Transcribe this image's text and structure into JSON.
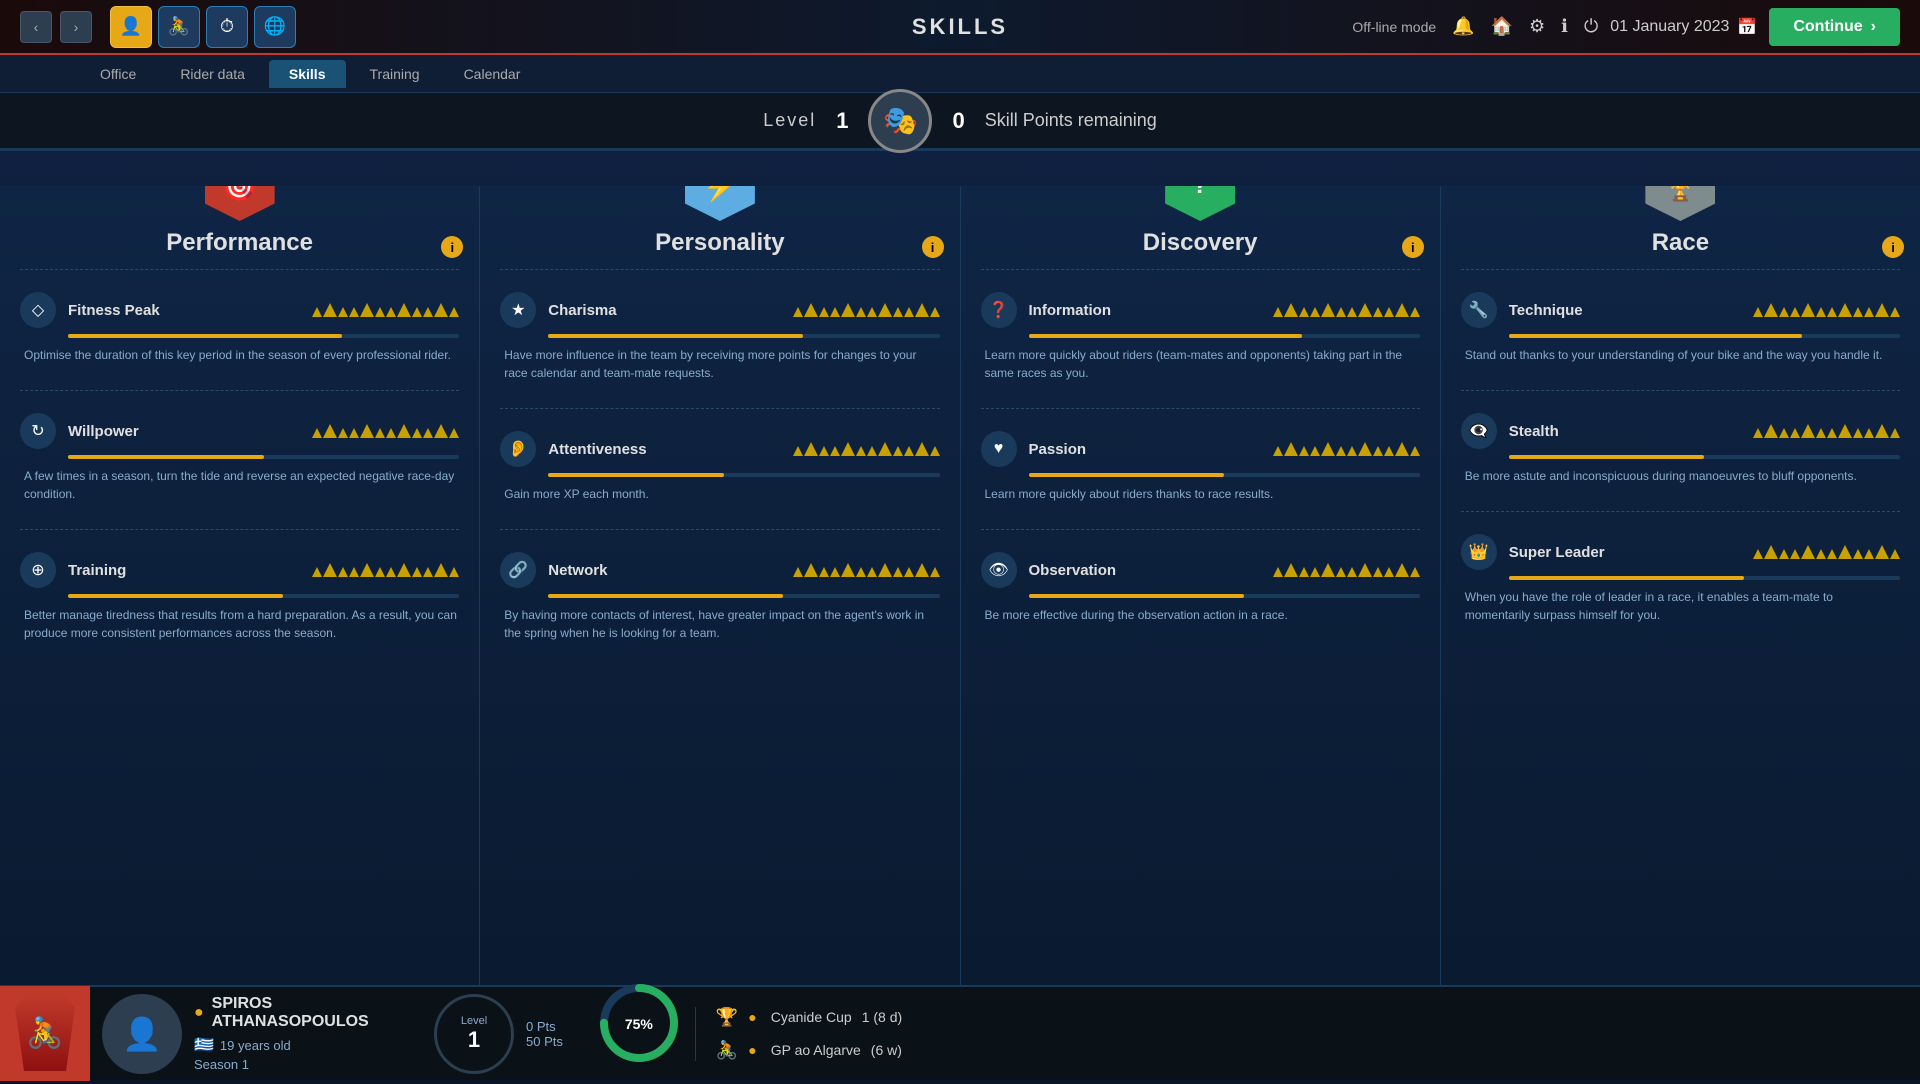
{
  "app": {
    "mode": "Off-line mode",
    "title": "SKILLS",
    "date": "01 January 2023",
    "continue_label": "Continue"
  },
  "tabs": {
    "items": [
      "Office",
      "Rider data",
      "Skills",
      "Training",
      "Calendar"
    ],
    "active": "Skills"
  },
  "level": {
    "label": "Level",
    "value": "1",
    "skill_points": "0",
    "skill_points_label": "Skill Points remaining"
  },
  "cards": [
    {
      "id": "performance",
      "title": "Performance",
      "color": "red",
      "icon": "🎯",
      "skills": [
        {
          "name": "Fitness Peak",
          "desc": "Optimise the duration of this key period in the season of every professional rider.",
          "bar": 70,
          "stars": [
            true,
            true,
            true,
            true,
            false
          ]
        },
        {
          "name": "Willpower",
          "desc": "A few times in a season, turn the tide and reverse an expected negative race-day condition.",
          "bar": 50,
          "stars": [
            true,
            true,
            true,
            true,
            false
          ]
        },
        {
          "name": "Training",
          "desc": "Better manage tiredness that results from a hard preparation. As a result, you can produce more consistent performances across the season.",
          "bar": 55,
          "stars": [
            true,
            true,
            true,
            true,
            false
          ]
        }
      ]
    },
    {
      "id": "personality",
      "title": "Personality",
      "color": "blue",
      "icon": "⚡",
      "skills": [
        {
          "name": "Charisma",
          "desc": "Have more influence in the team by receiving more points for changes to your race calendar and team-mate requests.",
          "bar": 65,
          "stars": [
            true,
            true,
            true,
            true,
            false
          ]
        },
        {
          "name": "Attentiveness",
          "desc": "Gain more XP each month.",
          "bar": 45,
          "stars": [
            true,
            true,
            true,
            true,
            false
          ]
        },
        {
          "name": "Network",
          "desc": "By having more contacts of interest, have greater impact on the agent's work in the spring when he is looking for a team.",
          "bar": 60,
          "stars": [
            true,
            true,
            true,
            true,
            false
          ]
        }
      ]
    },
    {
      "id": "discovery",
      "title": "Discovery",
      "color": "green",
      "icon": "?",
      "skills": [
        {
          "name": "Information",
          "desc": "Learn more quickly about riders (team-mates and opponents) taking part in the same races as you.",
          "bar": 70,
          "stars": [
            true,
            true,
            true,
            true,
            false
          ]
        },
        {
          "name": "Passion",
          "desc": "Learn more quickly about riders thanks to race results.",
          "bar": 50,
          "stars": [
            true,
            true,
            true,
            true,
            false
          ]
        },
        {
          "name": "Observation",
          "desc": "Be more effective during the observation action in a race.",
          "bar": 55,
          "stars": [
            true,
            true,
            true,
            true,
            false
          ]
        }
      ]
    },
    {
      "id": "race",
      "title": "Race",
      "color": "gray",
      "icon": "🏆",
      "skills": [
        {
          "name": "Technique",
          "desc": "Stand out thanks to your understanding of your bike and the way you handle it.",
          "bar": 75,
          "stars": [
            true,
            true,
            true,
            true,
            false
          ]
        },
        {
          "name": "Stealth",
          "desc": "Be more astute and inconspicuous during manoeuvres to bluff opponents.",
          "bar": 50,
          "stars": [
            true,
            true,
            true,
            true,
            false
          ]
        },
        {
          "name": "Super Leader",
          "desc": "When you have the role of leader in a race, it enables a team-mate to momentarily surpass himself for you.",
          "bar": 60,
          "stars": [
            true,
            true,
            true,
            true,
            false
          ]
        }
      ]
    }
  ],
  "rider": {
    "name": "SPIROS ATHANASOPOULOS",
    "age": "19 years old",
    "season": "Season 1",
    "level_label": "Level",
    "level": "1",
    "pts_current": "0 Pts",
    "pts_total": "50 Pts",
    "progress": 75,
    "progress_label": "75%"
  },
  "races": [
    {
      "name": "Cyanide Cup",
      "detail": "1 (8 d)"
    },
    {
      "name": "GP ao Algarve",
      "detail": "(6 w)"
    }
  ],
  "icons": {
    "bell": "🔔",
    "home": "🏠",
    "gear": "⚙",
    "info": "ℹ",
    "power": "⏻",
    "calendar": "📅",
    "arrow_left": "‹",
    "arrow_right": "›",
    "chevron_right": "›"
  }
}
